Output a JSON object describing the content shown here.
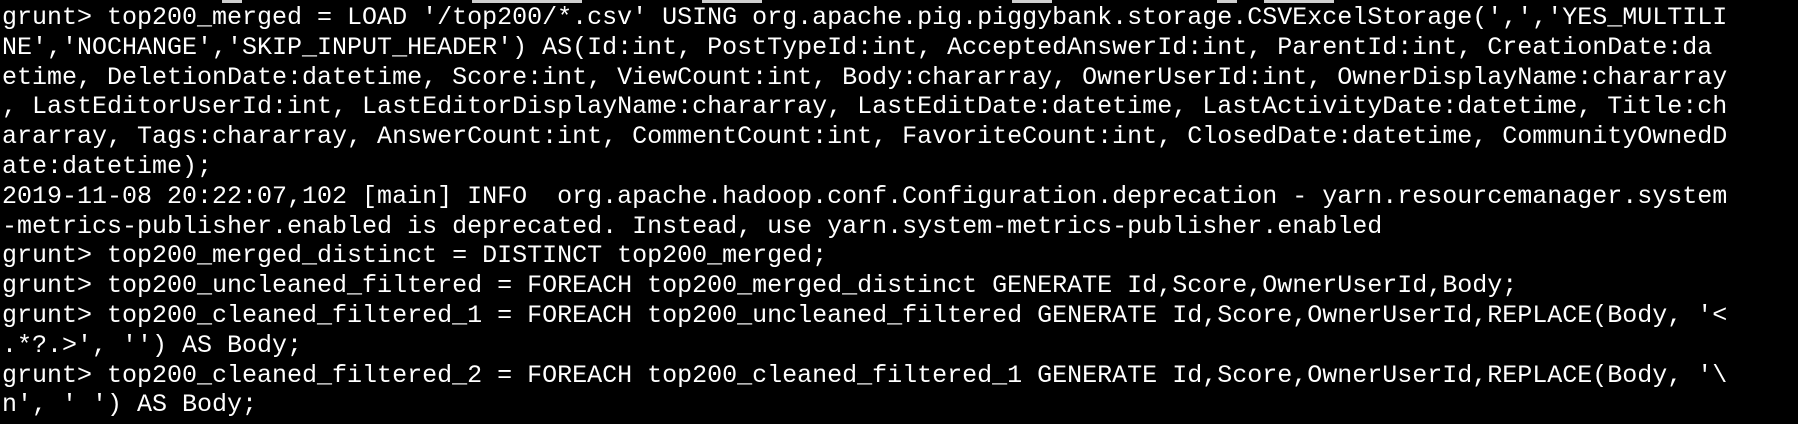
{
  "terminal": {
    "lines": [
      "grunt> top200_merged = LOAD '/top200/*.csv' USING org.apache.pig.piggybank.storage.CSVExcelStorage(',','YES_MULTILI",
      "NE','NOCHANGE','SKIP_INPUT_HEADER') AS(Id:int, PostTypeId:int, AcceptedAnswerId:int, ParentId:int, CreationDate:da",
      "etime, DeletionDate:datetime, Score:int, ViewCount:int, Body:chararray, OwnerUserId:int, OwnerDisplayName:chararray",
      ", LastEditorUserId:int, LastEditorDisplayName:chararray, LastEditDate:datetime, LastActivityDate:datetime, Title:ch",
      "ararray, Tags:chararray, AnswerCount:int, CommentCount:int, FavoriteCount:int, ClosedDate:datetime, CommunityOwnedD",
      "ate:datetime);",
      "2019-11-08 20:22:07,102 [main] INFO  org.apache.hadoop.conf.Configuration.deprecation - yarn.resourcemanager.system",
      "-metrics-publisher.enabled is deprecated. Instead, use yarn.system-metrics-publisher.enabled",
      "grunt> top200_merged_distinct = DISTINCT top200_merged;",
      "grunt> top200_uncleaned_filtered = FOREACH top200_merged_distinct GENERATE Id,Score,OwnerUserId,Body;",
      "grunt> top200_cleaned_filtered_1 = FOREACH top200_uncleaned_filtered GENERATE Id,Score,OwnerUserId,REPLACE(Body, '<",
      ".*?.>', '') AS Body;",
      "grunt> top200_cleaned_filtered_2 = FOREACH top200_cleaned_filtered_1 GENERATE Id,Score,OwnerUserId,REPLACE(Body, '\\",
      "n', ' ') AS Body;"
    ]
  },
  "colors": {
    "background": "#000000",
    "text": "#ffffff"
  }
}
